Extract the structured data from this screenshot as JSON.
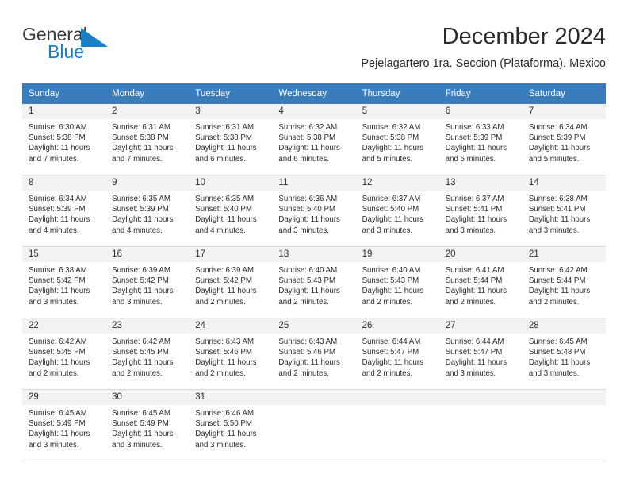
{
  "brand": {
    "name_part1": "General",
    "name_part2": "Blue",
    "logo_icon": "triangle-logo-icon",
    "accent_color": "#1b7fc4"
  },
  "header": {
    "month_title": "December 2024",
    "location": "Pejelagartero 1ra. Seccion (Plataforma), Mexico"
  },
  "calendar": {
    "header_color": "#3b7cbd",
    "weekdays": [
      "Sunday",
      "Monday",
      "Tuesday",
      "Wednesday",
      "Thursday",
      "Friday",
      "Saturday"
    ],
    "weeks": [
      [
        {
          "date": "1",
          "sunrise": "Sunrise: 6:30 AM",
          "sunset": "Sunset: 5:38 PM",
          "daylight_line1": "Daylight: 11 hours",
          "daylight_line2": "and 7 minutes."
        },
        {
          "date": "2",
          "sunrise": "Sunrise: 6:31 AM",
          "sunset": "Sunset: 5:38 PM",
          "daylight_line1": "Daylight: 11 hours",
          "daylight_line2": "and 7 minutes."
        },
        {
          "date": "3",
          "sunrise": "Sunrise: 6:31 AM",
          "sunset": "Sunset: 5:38 PM",
          "daylight_line1": "Daylight: 11 hours",
          "daylight_line2": "and 6 minutes."
        },
        {
          "date": "4",
          "sunrise": "Sunrise: 6:32 AM",
          "sunset": "Sunset: 5:38 PM",
          "daylight_line1": "Daylight: 11 hours",
          "daylight_line2": "and 6 minutes."
        },
        {
          "date": "5",
          "sunrise": "Sunrise: 6:32 AM",
          "sunset": "Sunset: 5:38 PM",
          "daylight_line1": "Daylight: 11 hours",
          "daylight_line2": "and 5 minutes."
        },
        {
          "date": "6",
          "sunrise": "Sunrise: 6:33 AM",
          "sunset": "Sunset: 5:39 PM",
          "daylight_line1": "Daylight: 11 hours",
          "daylight_line2": "and 5 minutes."
        },
        {
          "date": "7",
          "sunrise": "Sunrise: 6:34 AM",
          "sunset": "Sunset: 5:39 PM",
          "daylight_line1": "Daylight: 11 hours",
          "daylight_line2": "and 5 minutes."
        }
      ],
      [
        {
          "date": "8",
          "sunrise": "Sunrise: 6:34 AM",
          "sunset": "Sunset: 5:39 PM",
          "daylight_line1": "Daylight: 11 hours",
          "daylight_line2": "and 4 minutes."
        },
        {
          "date": "9",
          "sunrise": "Sunrise: 6:35 AM",
          "sunset": "Sunset: 5:39 PM",
          "daylight_line1": "Daylight: 11 hours",
          "daylight_line2": "and 4 minutes."
        },
        {
          "date": "10",
          "sunrise": "Sunrise: 6:35 AM",
          "sunset": "Sunset: 5:40 PM",
          "daylight_line1": "Daylight: 11 hours",
          "daylight_line2": "and 4 minutes."
        },
        {
          "date": "11",
          "sunrise": "Sunrise: 6:36 AM",
          "sunset": "Sunset: 5:40 PM",
          "daylight_line1": "Daylight: 11 hours",
          "daylight_line2": "and 3 minutes."
        },
        {
          "date": "12",
          "sunrise": "Sunrise: 6:37 AM",
          "sunset": "Sunset: 5:40 PM",
          "daylight_line1": "Daylight: 11 hours",
          "daylight_line2": "and 3 minutes."
        },
        {
          "date": "13",
          "sunrise": "Sunrise: 6:37 AM",
          "sunset": "Sunset: 5:41 PM",
          "daylight_line1": "Daylight: 11 hours",
          "daylight_line2": "and 3 minutes."
        },
        {
          "date": "14",
          "sunrise": "Sunrise: 6:38 AM",
          "sunset": "Sunset: 5:41 PM",
          "daylight_line1": "Daylight: 11 hours",
          "daylight_line2": "and 3 minutes."
        }
      ],
      [
        {
          "date": "15",
          "sunrise": "Sunrise: 6:38 AM",
          "sunset": "Sunset: 5:42 PM",
          "daylight_line1": "Daylight: 11 hours",
          "daylight_line2": "and 3 minutes."
        },
        {
          "date": "16",
          "sunrise": "Sunrise: 6:39 AM",
          "sunset": "Sunset: 5:42 PM",
          "daylight_line1": "Daylight: 11 hours",
          "daylight_line2": "and 3 minutes."
        },
        {
          "date": "17",
          "sunrise": "Sunrise: 6:39 AM",
          "sunset": "Sunset: 5:42 PM",
          "daylight_line1": "Daylight: 11 hours",
          "daylight_line2": "and 2 minutes."
        },
        {
          "date": "18",
          "sunrise": "Sunrise: 6:40 AM",
          "sunset": "Sunset: 5:43 PM",
          "daylight_line1": "Daylight: 11 hours",
          "daylight_line2": "and 2 minutes."
        },
        {
          "date": "19",
          "sunrise": "Sunrise: 6:40 AM",
          "sunset": "Sunset: 5:43 PM",
          "daylight_line1": "Daylight: 11 hours",
          "daylight_line2": "and 2 minutes."
        },
        {
          "date": "20",
          "sunrise": "Sunrise: 6:41 AM",
          "sunset": "Sunset: 5:44 PM",
          "daylight_line1": "Daylight: 11 hours",
          "daylight_line2": "and 2 minutes."
        },
        {
          "date": "21",
          "sunrise": "Sunrise: 6:42 AM",
          "sunset": "Sunset: 5:44 PM",
          "daylight_line1": "Daylight: 11 hours",
          "daylight_line2": "and 2 minutes."
        }
      ],
      [
        {
          "date": "22",
          "sunrise": "Sunrise: 6:42 AM",
          "sunset": "Sunset: 5:45 PM",
          "daylight_line1": "Daylight: 11 hours",
          "daylight_line2": "and 2 minutes."
        },
        {
          "date": "23",
          "sunrise": "Sunrise: 6:42 AM",
          "sunset": "Sunset: 5:45 PM",
          "daylight_line1": "Daylight: 11 hours",
          "daylight_line2": "and 2 minutes."
        },
        {
          "date": "24",
          "sunrise": "Sunrise: 6:43 AM",
          "sunset": "Sunset: 5:46 PM",
          "daylight_line1": "Daylight: 11 hours",
          "daylight_line2": "and 2 minutes."
        },
        {
          "date": "25",
          "sunrise": "Sunrise: 6:43 AM",
          "sunset": "Sunset: 5:46 PM",
          "daylight_line1": "Daylight: 11 hours",
          "daylight_line2": "and 2 minutes."
        },
        {
          "date": "26",
          "sunrise": "Sunrise: 6:44 AM",
          "sunset": "Sunset: 5:47 PM",
          "daylight_line1": "Daylight: 11 hours",
          "daylight_line2": "and 2 minutes."
        },
        {
          "date": "27",
          "sunrise": "Sunrise: 6:44 AM",
          "sunset": "Sunset: 5:47 PM",
          "daylight_line1": "Daylight: 11 hours",
          "daylight_line2": "and 3 minutes."
        },
        {
          "date": "28",
          "sunrise": "Sunrise: 6:45 AM",
          "sunset": "Sunset: 5:48 PM",
          "daylight_line1": "Daylight: 11 hours",
          "daylight_line2": "and 3 minutes."
        }
      ],
      [
        {
          "date": "29",
          "sunrise": "Sunrise: 6:45 AM",
          "sunset": "Sunset: 5:49 PM",
          "daylight_line1": "Daylight: 11 hours",
          "daylight_line2": "and 3 minutes."
        },
        {
          "date": "30",
          "sunrise": "Sunrise: 6:45 AM",
          "sunset": "Sunset: 5:49 PM",
          "daylight_line1": "Daylight: 11 hours",
          "daylight_line2": "and 3 minutes."
        },
        {
          "date": "31",
          "sunrise": "Sunrise: 6:46 AM",
          "sunset": "Sunset: 5:50 PM",
          "daylight_line1": "Daylight: 11 hours",
          "daylight_line2": "and 3 minutes."
        },
        {
          "date": "",
          "sunrise": "",
          "sunset": "",
          "daylight_line1": "",
          "daylight_line2": ""
        },
        {
          "date": "",
          "sunrise": "",
          "sunset": "",
          "daylight_line1": "",
          "daylight_line2": ""
        },
        {
          "date": "",
          "sunrise": "",
          "sunset": "",
          "daylight_line1": "",
          "daylight_line2": ""
        },
        {
          "date": "",
          "sunrise": "",
          "sunset": "",
          "daylight_line1": "",
          "daylight_line2": ""
        }
      ]
    ]
  }
}
